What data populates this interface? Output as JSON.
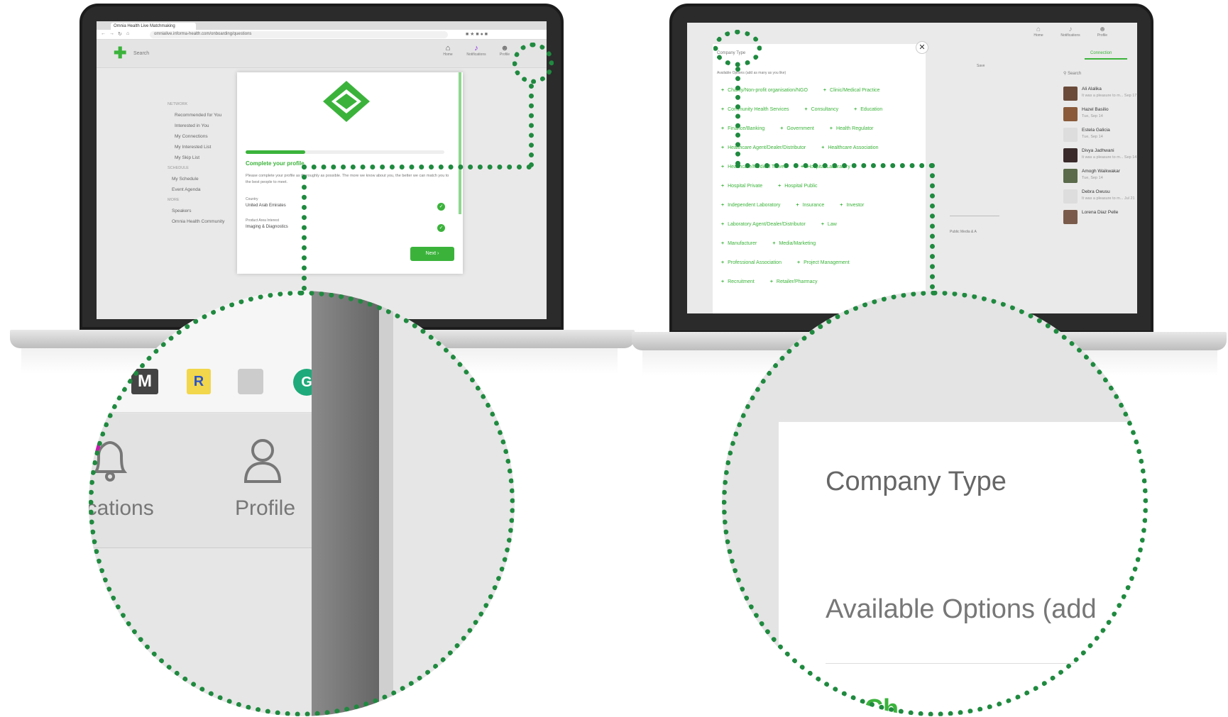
{
  "left_screen": {
    "browser_tab_title": "Omnia Health Live Matchmaking",
    "url": "omnialive.informa-health.com/onboarding/questions",
    "search_placeholder": "Search",
    "header_icons": [
      {
        "label": "Home",
        "icon": "home-icon"
      },
      {
        "label": "Notifications",
        "icon": "bell-icon"
      },
      {
        "label": "Profile",
        "icon": "user-icon"
      }
    ],
    "sidebar": {
      "section1": "NETWORK",
      "items1": [
        "Recommended for You",
        "Interested in You",
        "My Connections",
        "My Interested List",
        "My Skip List"
      ],
      "section2": "SCHEDULE",
      "items2": [
        "My Schedule",
        "Event Agenda"
      ],
      "section3": "MORE",
      "items3": [
        "Speakers",
        "Omnia Health Community"
      ]
    },
    "modal": {
      "logo_icon": "handshake-icon",
      "progress": 0.3,
      "title": "Complete your profile",
      "description": "Please complete your profile as thoroughly as possible. The more we know about you, the better we can match you to the best people to meet.",
      "field1_label": "Country",
      "field1_value": "United Arab Emirates",
      "field2_label": "Product Area Interest",
      "field2_value": "Imaging & Diagnostics",
      "next_label": "Next"
    }
  },
  "right_screen": {
    "header_icons": [
      {
        "label": "Home",
        "icon": "home-icon"
      },
      {
        "label": "Notifications",
        "icon": "bell-icon"
      },
      {
        "label": "Profile",
        "icon": "user-icon"
      }
    ],
    "close_icon": "close-icon",
    "company_type_title": "Company Type",
    "available_hint": "Available Options (add as many as you like)",
    "options": [
      [
        "Charity/Non-profit organisation/NGO",
        "Clinic/Medical Practice"
      ],
      [
        "Community Health Services",
        "Consultancy",
        "Education"
      ],
      [
        "Finance/Banking",
        "Government",
        "Health Regulator"
      ],
      [
        "Healthcare Agent/Dealer/Distributor",
        "Healthcare Association"
      ],
      [
        "Healthcare/Medical Travel",
        "Hospital Laboratory"
      ],
      [
        "Hospital Private",
        "Hospital Public"
      ],
      [
        "Independent Laboratory",
        "Insurance",
        "Investor"
      ],
      [
        "Laboratory Agent/Dealer/Distributor",
        "Law"
      ],
      [
        "Manufacturer",
        "Media/Marketing"
      ],
      [
        "Professional Association",
        "Project Management"
      ],
      [
        "Recruitment",
        "Retailer/Pharmacy"
      ]
    ],
    "bg_text1": "Save",
    "bg_text2": "Public Media & A",
    "connections_tab": "Connection",
    "search_placeholder": "Search",
    "contacts": [
      {
        "name": "Ali Alalika",
        "sub": "It was a pleasure to m... Sep 17"
      },
      {
        "name": "Hazel Basilio",
        "sub": "Tue, Sep 14"
      },
      {
        "name": "Estela Galicia",
        "sub": "Tue, Sep 14"
      },
      {
        "name": "Divya Jadhwani",
        "sub": "It was a pleasure to m... Sep 14"
      },
      {
        "name": "Amogh Waikwakar",
        "sub": "Tue, Sep 14"
      },
      {
        "name": "Debra Owusu",
        "sub": "It was a pleasure to m... Jul 21"
      },
      {
        "name": "Lorena Diaz Pelle",
        "sub": ""
      }
    ]
  },
  "zoom_left": {
    "ext_icons": [
      "M",
      "R"
    ],
    "notifications_label": "ications",
    "profile_label": "Profile"
  },
  "zoom_right": {
    "title": "Company Type",
    "hint": "Available Options (add",
    "bottom_text": "Ch"
  },
  "colors": {
    "accent": "#3bb33b",
    "dots": "#1f8a3f"
  }
}
